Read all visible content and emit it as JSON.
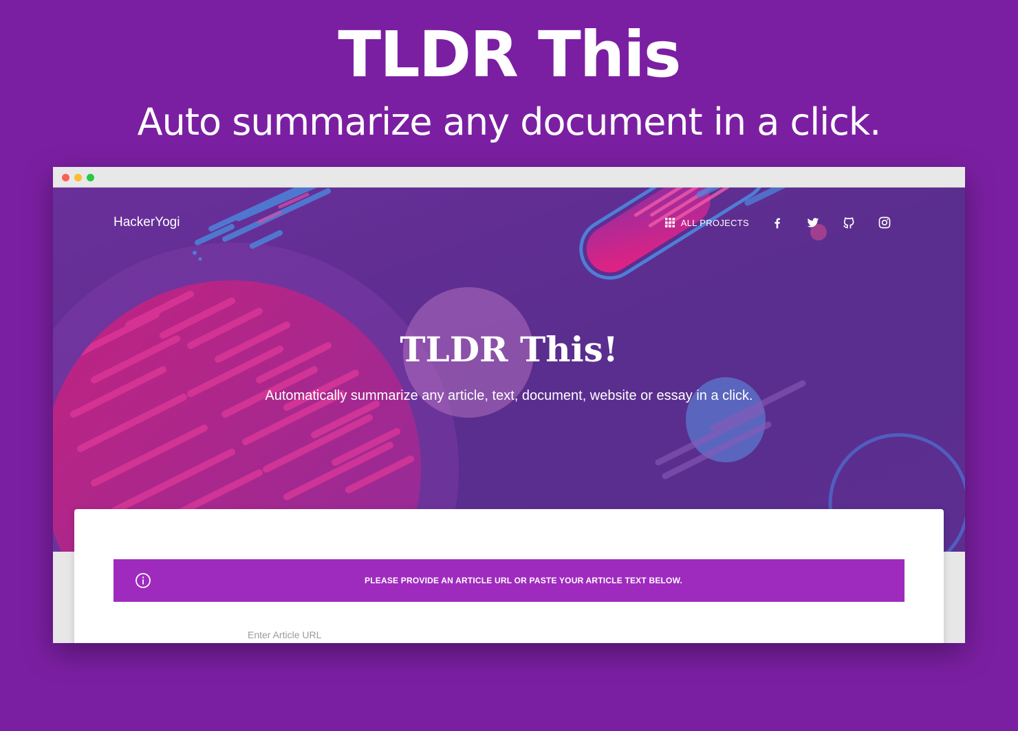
{
  "promo": {
    "title": "TLDR This",
    "subtitle": "Auto summarize any document in a click."
  },
  "window": {
    "controls": [
      "close",
      "minimize",
      "maximize"
    ]
  },
  "navbar": {
    "brand": "HackerYogi",
    "all_projects": "ALL PROJECTS",
    "social_icons": [
      "facebook-icon",
      "twitter-icon",
      "github-icon",
      "instagram-icon"
    ]
  },
  "hero": {
    "title": "TLDR This!",
    "description": "Automatically summarize any article, text, document, website or essay in a click."
  },
  "card": {
    "alert_text": "PLEASE PROVIDE AN ARTICLE URL OR PASTE YOUR ARTICLE TEXT BELOW.",
    "url_placeholder": "Enter Article URL",
    "url_value": ""
  },
  "colors": {
    "page_background": "#7b1fa2",
    "hero_background": "#5b2e90",
    "alert_background": "#9f2bbe",
    "accent_pink": "#d81b8c",
    "accent_blue": "#4e7fd6"
  }
}
